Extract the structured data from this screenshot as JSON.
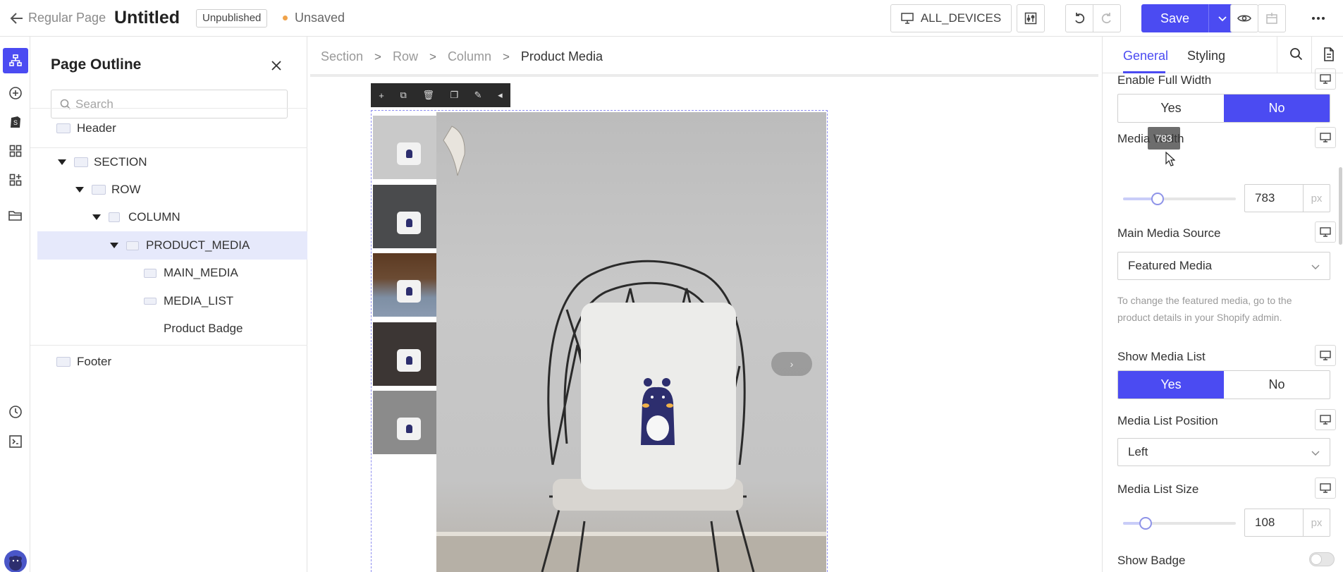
{
  "topbar": {
    "page_type": "Regular Page",
    "title": "Untitled",
    "status_pill": "Unpublished",
    "save_state": "Unsaved",
    "devices_label": "ALL_DEVICES",
    "save_label": "Save"
  },
  "outline": {
    "title": "Page Outline",
    "search_placeholder": "Search",
    "items": [
      {
        "label": "Header"
      },
      {
        "label": "SECTION"
      },
      {
        "label": "ROW"
      },
      {
        "label": "COLUMN"
      },
      {
        "label": "PRODUCT_MEDIA"
      },
      {
        "label": "MAIN_MEDIA"
      },
      {
        "label": "MEDIA_LIST"
      },
      {
        "label": "Product Badge"
      },
      {
        "label": "Footer"
      }
    ]
  },
  "breadcrumb": [
    "Section",
    "Row",
    "Column",
    "Product Media"
  ],
  "panel": {
    "tabs": [
      "General",
      "Styling"
    ],
    "enable_full_width": {
      "label": "Enable Full Width",
      "options": [
        "Yes",
        "No"
      ],
      "selected": "No"
    },
    "media_width": {
      "label": "Media Width",
      "value": "783",
      "unit": "px",
      "tooltip": "783",
      "level": 0.3
    },
    "main_media_source": {
      "label": "Main Media Source",
      "value": "Featured Media",
      "help": "To change the featured media, go to the product details in your Shopify admin."
    },
    "show_media_list": {
      "label": "Show Media List",
      "options": [
        "Yes",
        "No"
      ],
      "selected": "Yes"
    },
    "media_list_position": {
      "label": "Media List Position",
      "value": "Left"
    },
    "media_list_size": {
      "label": "Media List Size",
      "value": "108",
      "unit": "px",
      "level": 0.2
    },
    "show_badge": {
      "label": "Show Badge",
      "on": false
    }
  },
  "colors": {
    "accent": "#4b4bf2",
    "selected_row": "#e6e9fb",
    "unsaved_dot": "#f0a34a"
  }
}
